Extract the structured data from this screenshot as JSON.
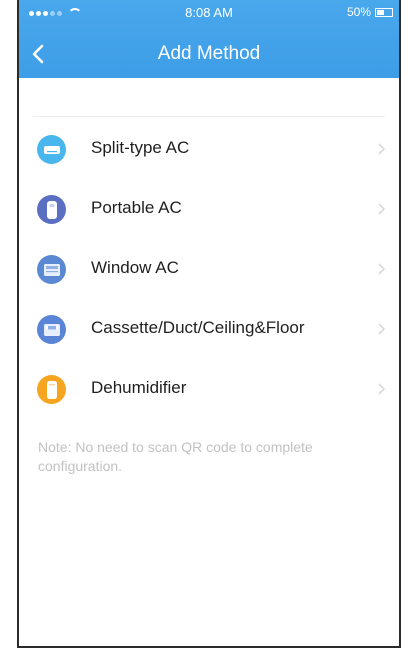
{
  "status_bar": {
    "time": "8:08 AM",
    "battery": "50%",
    "battery_level": 0.5
  },
  "header": {
    "title": "Add Method",
    "back_icon": "chevron-left-icon"
  },
  "methods": [
    {
      "label": "Split-type AC",
      "icon": "split-ac-icon",
      "color": "#4ab6ee"
    },
    {
      "label": "Portable AC",
      "icon": "portable-ac-icon",
      "color": "#5b6fc2"
    },
    {
      "label": "Window AC",
      "icon": "window-ac-icon",
      "color": "#5a88d3"
    },
    {
      "label": "Cassette/Duct/Ceiling&Floor",
      "icon": "cassette-ac-icon",
      "color": "#5a84d6"
    },
    {
      "label": "Dehumidifier",
      "icon": "dehumidifier-icon",
      "color": "#f5a51f"
    }
  ],
  "note": "Note: No need to scan QR code to complete configuration.",
  "colors": {
    "header": "#3d9de6",
    "chevron": "#d8d8d8",
    "note_text": "#c2c2c2"
  }
}
